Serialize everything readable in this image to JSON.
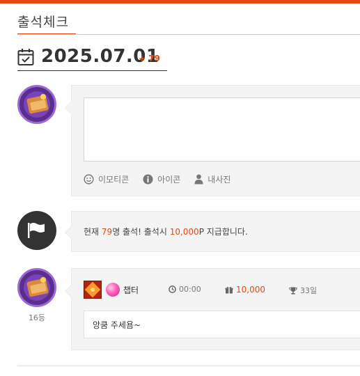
{
  "page": {
    "tab_label": "출석체크",
    "date": "2025.07.01",
    "attendance_delta": "+ 79"
  },
  "compose": {
    "placeholder": "",
    "tools": {
      "emoticon": "이모티콘",
      "icon": "아이콘",
      "my_photo": "내사진"
    }
  },
  "notice": {
    "prefix": "현재 ",
    "count": "79",
    "middle": "명 출석! 출석시 ",
    "points": "10,000",
    "suffix": "P 지급합니다."
  },
  "entry": {
    "rank": "16등",
    "nickname": "챕터",
    "time": "00:00",
    "points": "10,000",
    "days": "33일",
    "message": "앙쿰 주세욤~"
  },
  "colors": {
    "accent": "#e8470f",
    "card_bg": "#f4f4f4",
    "avatar_purple": "#5a2d8f"
  },
  "icons": {
    "calendar": "calendar-check-icon",
    "emoticon": "smile-icon",
    "icon": "info-icon",
    "photo": "person-icon",
    "flag": "flag-icon",
    "time": "clock-icon",
    "point": "gift-icon",
    "days": "trophy-icon"
  }
}
